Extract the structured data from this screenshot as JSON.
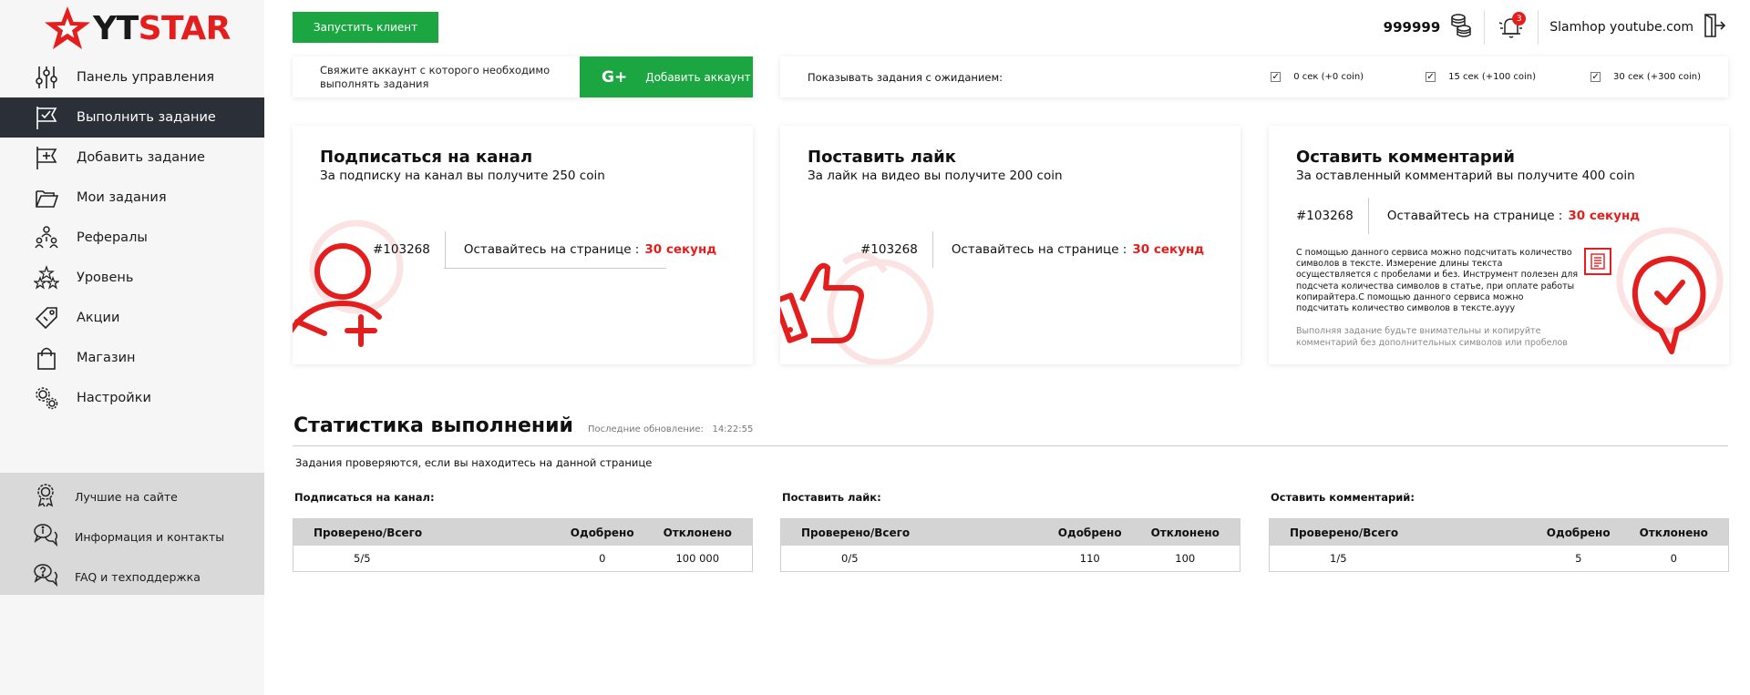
{
  "brand": {
    "name_part1": "YT",
    "name_part2": "STAR",
    "accent": "#e41d1d",
    "green": "#1ba642",
    "dark": "#2b2f37"
  },
  "sidebar": {
    "items": [
      {
        "label": "Панель управления",
        "icon": "sliders-icon"
      },
      {
        "label": "Выполнить задание",
        "icon": "flag-check-icon",
        "active": true
      },
      {
        "label": "Добавить задание",
        "icon": "flag-plus-icon"
      },
      {
        "label": "Мои задания",
        "icon": "folder-open-icon"
      },
      {
        "label": "Рефералы",
        "icon": "referrals-icon"
      },
      {
        "label": "Уровень",
        "icon": "stars-icon"
      },
      {
        "label": "Акции",
        "icon": "tag-icon"
      },
      {
        "label": "Магазин",
        "icon": "shopping-bag-icon"
      },
      {
        "label": "Настройки",
        "icon": "gears-icon"
      }
    ],
    "bottom": [
      {
        "label": "Лучшие на сайте",
        "icon": "award-icon"
      },
      {
        "label": "Информация и контакты",
        "icon": "chat-info-icon"
      },
      {
        "label": "FAQ и техподдержка",
        "icon": "chat-question-icon"
      }
    ]
  },
  "topbar": {
    "launch_label": "Запустить клиент",
    "balance": "999999",
    "notifications": "3",
    "username": "Slamhop youtube.com"
  },
  "account": {
    "text": "Свяжите аккаунт с которого необходимо выполнять задания",
    "google_icon_text": "G+",
    "add_label": "Добавить аккаунт"
  },
  "filter": {
    "label": "Показывать задания с ожиданием:",
    "options": [
      {
        "label": "0 сек (+0 coin)",
        "checked": true
      },
      {
        "label": "15 сек (+100 coin)",
        "checked": true
      },
      {
        "label": "30 сек (+300 coin)",
        "checked": true
      }
    ]
  },
  "tasks": [
    {
      "title": "Подписаться на канал",
      "subtitle": "За подписку на канал вы получите 250 coin",
      "id": "#103268",
      "stay_label": "Оставайтесь на странице :",
      "stay_value": "30 секунд"
    },
    {
      "title": "Поставить лайк",
      "subtitle": "За лайк на видео вы получите 200 coin",
      "id": "#103268",
      "stay_label": "Оставайтесь на странице :",
      "stay_value": "30 секунд"
    },
    {
      "title": "Оставить комментарий",
      "subtitle": "За оставленный комментарий вы получите 400 coin",
      "id": "#103268",
      "stay_label": "Оставайтесь на странице :",
      "stay_value": "30 секунд",
      "comment": "С помощью данного сервиса можно подсчитать количество символов в тексте. Измерение длины текста осуществляется с пробелами и без. Инструмент полезен для подсчета количества символов в статье, при оплате работы копирайтера.С помощью данного сервиса можно подсчитать количество символов в тексте.ayyy",
      "note": "Выполняя задание будьте внимательны и копируйте комментарий без дополнительных символов или пробелов"
    }
  ],
  "stats": {
    "title": "Статистика выполнений",
    "updated_label": "Последние обновление:",
    "updated_time": "14:22:55",
    "note": "Задания проверяются, если вы находитесь на данной странице",
    "columns": {
      "total": "Проверено/Всего",
      "approved": "Одобрено",
      "rejected": "Отклонено"
    },
    "blocks": [
      {
        "title": "Подписаться на канал:",
        "total": "5/5",
        "approved": "0",
        "rejected": "100 000"
      },
      {
        "title": "Поставить лайк:",
        "total": "0/5",
        "approved": "110",
        "rejected": "100"
      },
      {
        "title": "Оставить комментарий:",
        "total": "1/5",
        "approved": "5",
        "rejected": "0"
      }
    ]
  }
}
